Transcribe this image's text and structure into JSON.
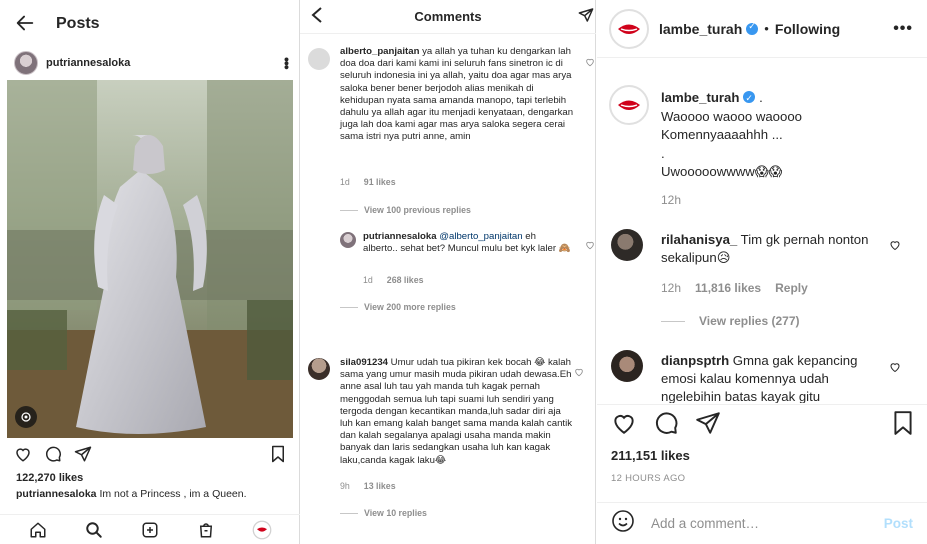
{
  "left": {
    "header_title": "Posts",
    "username": "putriannesaloka",
    "likes": "122,270 likes",
    "caption_user": "putriannesaloka",
    "caption_text": " Im not a Princess , im a Queen."
  },
  "middle": {
    "header_title": "Comments",
    "c1": {
      "user": "alberto_panjaitan",
      "text": " ya allah ya tuhan ku dengarkan lah doa doa dari kami kami ini seluruh fans sinetron ic di seluruh indonesia ini ya allah, yaitu doa agar mas arya saloka bener bener berjodoh alias menikah di kehidupan nyata sama amanda manopo, tapi terlebih dahulu ya allah agar itu menjadi kenyataan, dengarkan juga lah doa kami agar mas arya saloka segera cerai sama istri nya putri anne, amin",
      "time": "1d",
      "likes": "91 likes",
      "view_replies": "View 100 previous replies"
    },
    "r1": {
      "user": "putriannesaloka",
      "mention": " @alberto_panjaitan",
      "text": " eh alberto.. sehat bet? Muncul mulu bet kyk laler 🙈",
      "time": "1d",
      "likes": "268 likes",
      "view_replies": "View 200 more replies"
    },
    "c2": {
      "user": "sila091234",
      "text": " Umur udah tua pikiran kek bocah 😂 kalah sama yang umur masih muda pikiran udah dewasa.Eh anne asal luh tau yah manda tuh kagak pernah menggodah semua luh tapi suami luh sendiri yang tergoda dengan kecantikan manda,luh sadar diri aja luh kan emang kalah banget sama manda kalah cantik dan kalah segalanya apalagi usaha manda makin banyak dan laris sedangkan usaha luh kan kagak laku,canda kagak laku😂",
      "time": "9h",
      "likes": "13 likes",
      "view_replies": "View 10 replies"
    }
  },
  "right": {
    "username": "lambe_turah",
    "dot": "•",
    "following": "Following",
    "caption_user": "lambe_turah",
    "caption_lines": [
      " .",
      "Waoooo waooo waoooo",
      "Komennyaaaahhh ...",
      ".",
      "Uwooooowwww😱😱"
    ],
    "caption_time": "12h",
    "c1": {
      "user": "rilahanisya_",
      "text": " Tim gk pernah nonton sekalipun😥",
      "time": "12h",
      "likes": "11,816 likes",
      "reply": "Reply",
      "view_replies": "View replies (277)"
    },
    "c2": {
      "user": "dianpsptrh",
      "text_1": " Gmna gak kepancing",
      "text_2": "emosi kalau komennya udah",
      "text_3": "ngelebihin batas kayak gitu"
    },
    "likes": "211,151 likes",
    "ago": "12 HOURS AGO",
    "add_comment_placeholder": "Add a comment…",
    "post_label": "Post"
  },
  "colors": {
    "link": "#00376b",
    "muted": "#8e8e8e",
    "verified": "#3897f0",
    "post_disabled": "#b2dffc"
  }
}
